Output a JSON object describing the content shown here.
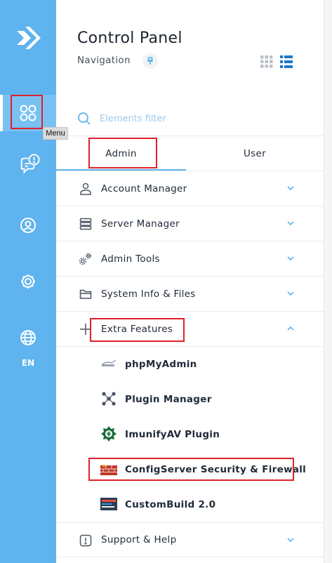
{
  "tooltip": "Menu",
  "rail": {
    "language": "EN",
    "icons": [
      "logo-icon",
      "apps-grid-icon",
      "message-alert-icon",
      "user-circle-icon",
      "settings-gear-icon",
      "globe-icon"
    ]
  },
  "panel": {
    "title": "Control Panel",
    "subtitle": "Navigation",
    "filter_placeholder": "Elements filter",
    "tabs": [
      "Admin",
      "User"
    ],
    "active_tab": "Admin"
  },
  "menu": {
    "account_manager": "Account Manager",
    "server_manager": "Server Manager",
    "admin_tools": "Admin Tools",
    "system_info": "System Info & Files",
    "extra_features": "Extra Features",
    "extra_items": [
      "phpMyAdmin",
      "Plugin Manager",
      "ImunifyAV Plugin",
      "ConfigServer Security & Firewall",
      "CustomBuild 2.0"
    ],
    "support_help": "Support & Help"
  },
  "colors": {
    "accent": "#5fb3ee",
    "highlight": "#e0202a"
  }
}
